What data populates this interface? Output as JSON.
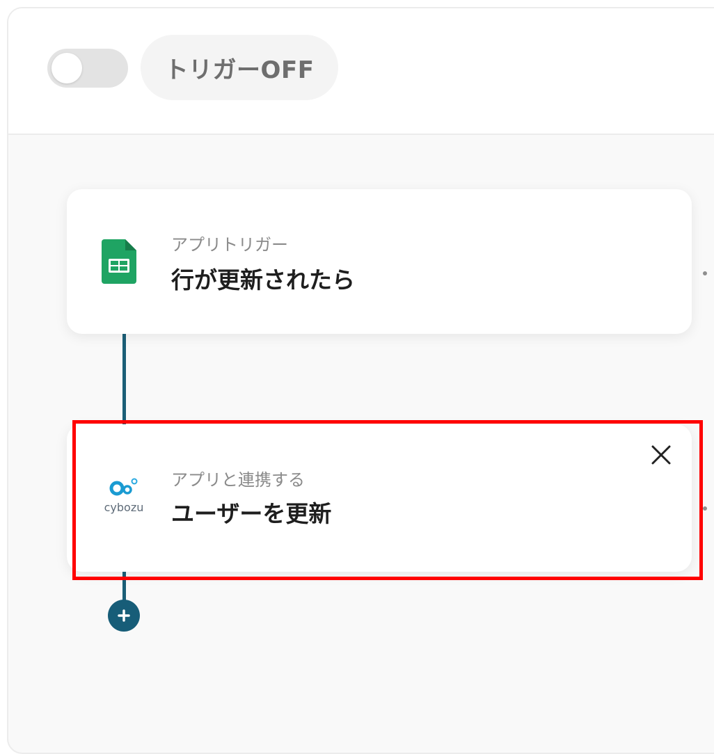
{
  "header": {
    "trigger_label": "トリガーOFF"
  },
  "flow": {
    "steps": [
      {
        "subtitle": "アプリトリガー",
        "title": "行が更新されたら",
        "icon": "google-sheets-icon"
      },
      {
        "subtitle": "アプリと連携する",
        "title": "ユーザーを更新",
        "icon": "cybozu-icon",
        "icon_text": "cybozu"
      }
    ]
  },
  "colors": {
    "connector": "#1b5f77",
    "highlight": "#ff0000",
    "sheets_green": "#1fa463"
  }
}
